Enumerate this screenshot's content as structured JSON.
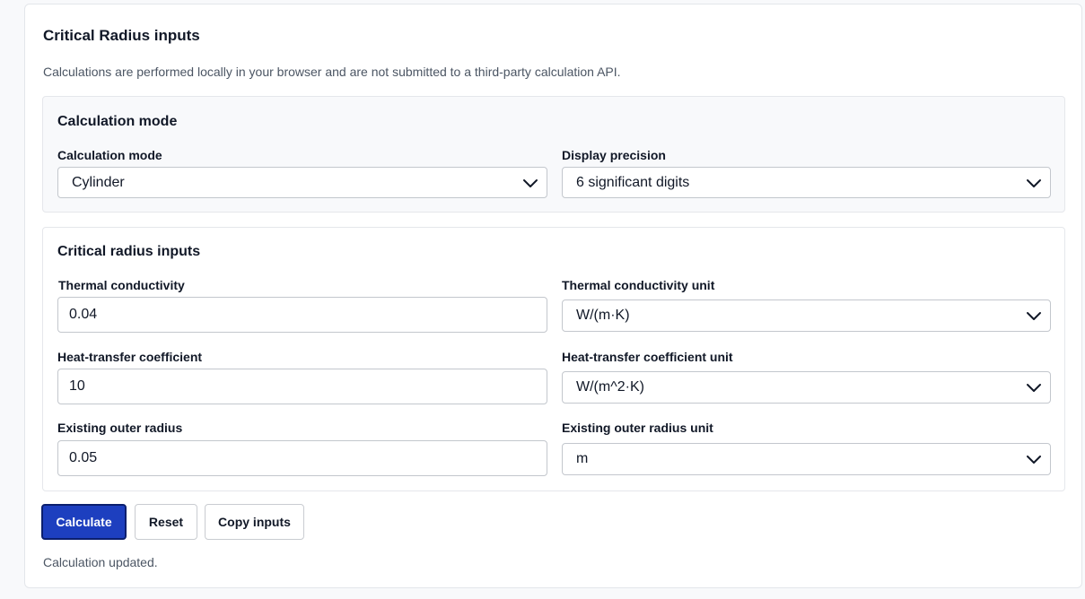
{
  "card": {
    "title": "Critical Radius inputs",
    "note": "Calculations are performed locally in your browser and are not submitted to a third-party calculation API."
  },
  "mode_panel": {
    "title": "Calculation mode",
    "mode_label": "Calculation mode",
    "mode_value": "Cylinder",
    "precision_label": "Display precision",
    "precision_value": "6 significant digits"
  },
  "inputs_panel": {
    "title": "Critical radius inputs",
    "k_label": "Thermal conductivity",
    "k_value": "0.04",
    "k_unit_label": "Thermal conductivity unit",
    "k_unit_value": "W/(m·K)",
    "h_label": "Heat-transfer coefficient",
    "h_value": "10",
    "h_unit_label": "Heat-transfer coefficient unit",
    "h_unit_value": "W/(m^2·K)",
    "r_label": "Existing outer radius",
    "r_value": "0.05",
    "r_unit_label": "Existing outer radius unit",
    "r_unit_value": "m"
  },
  "actions": {
    "calculate": "Calculate",
    "reset": "Reset",
    "copy": "Copy inputs"
  },
  "status": "Calculation updated.",
  "colors": {
    "primary": "#1d3fbf",
    "border": "#c3c7cd",
    "muted_text": "#4b5563"
  }
}
